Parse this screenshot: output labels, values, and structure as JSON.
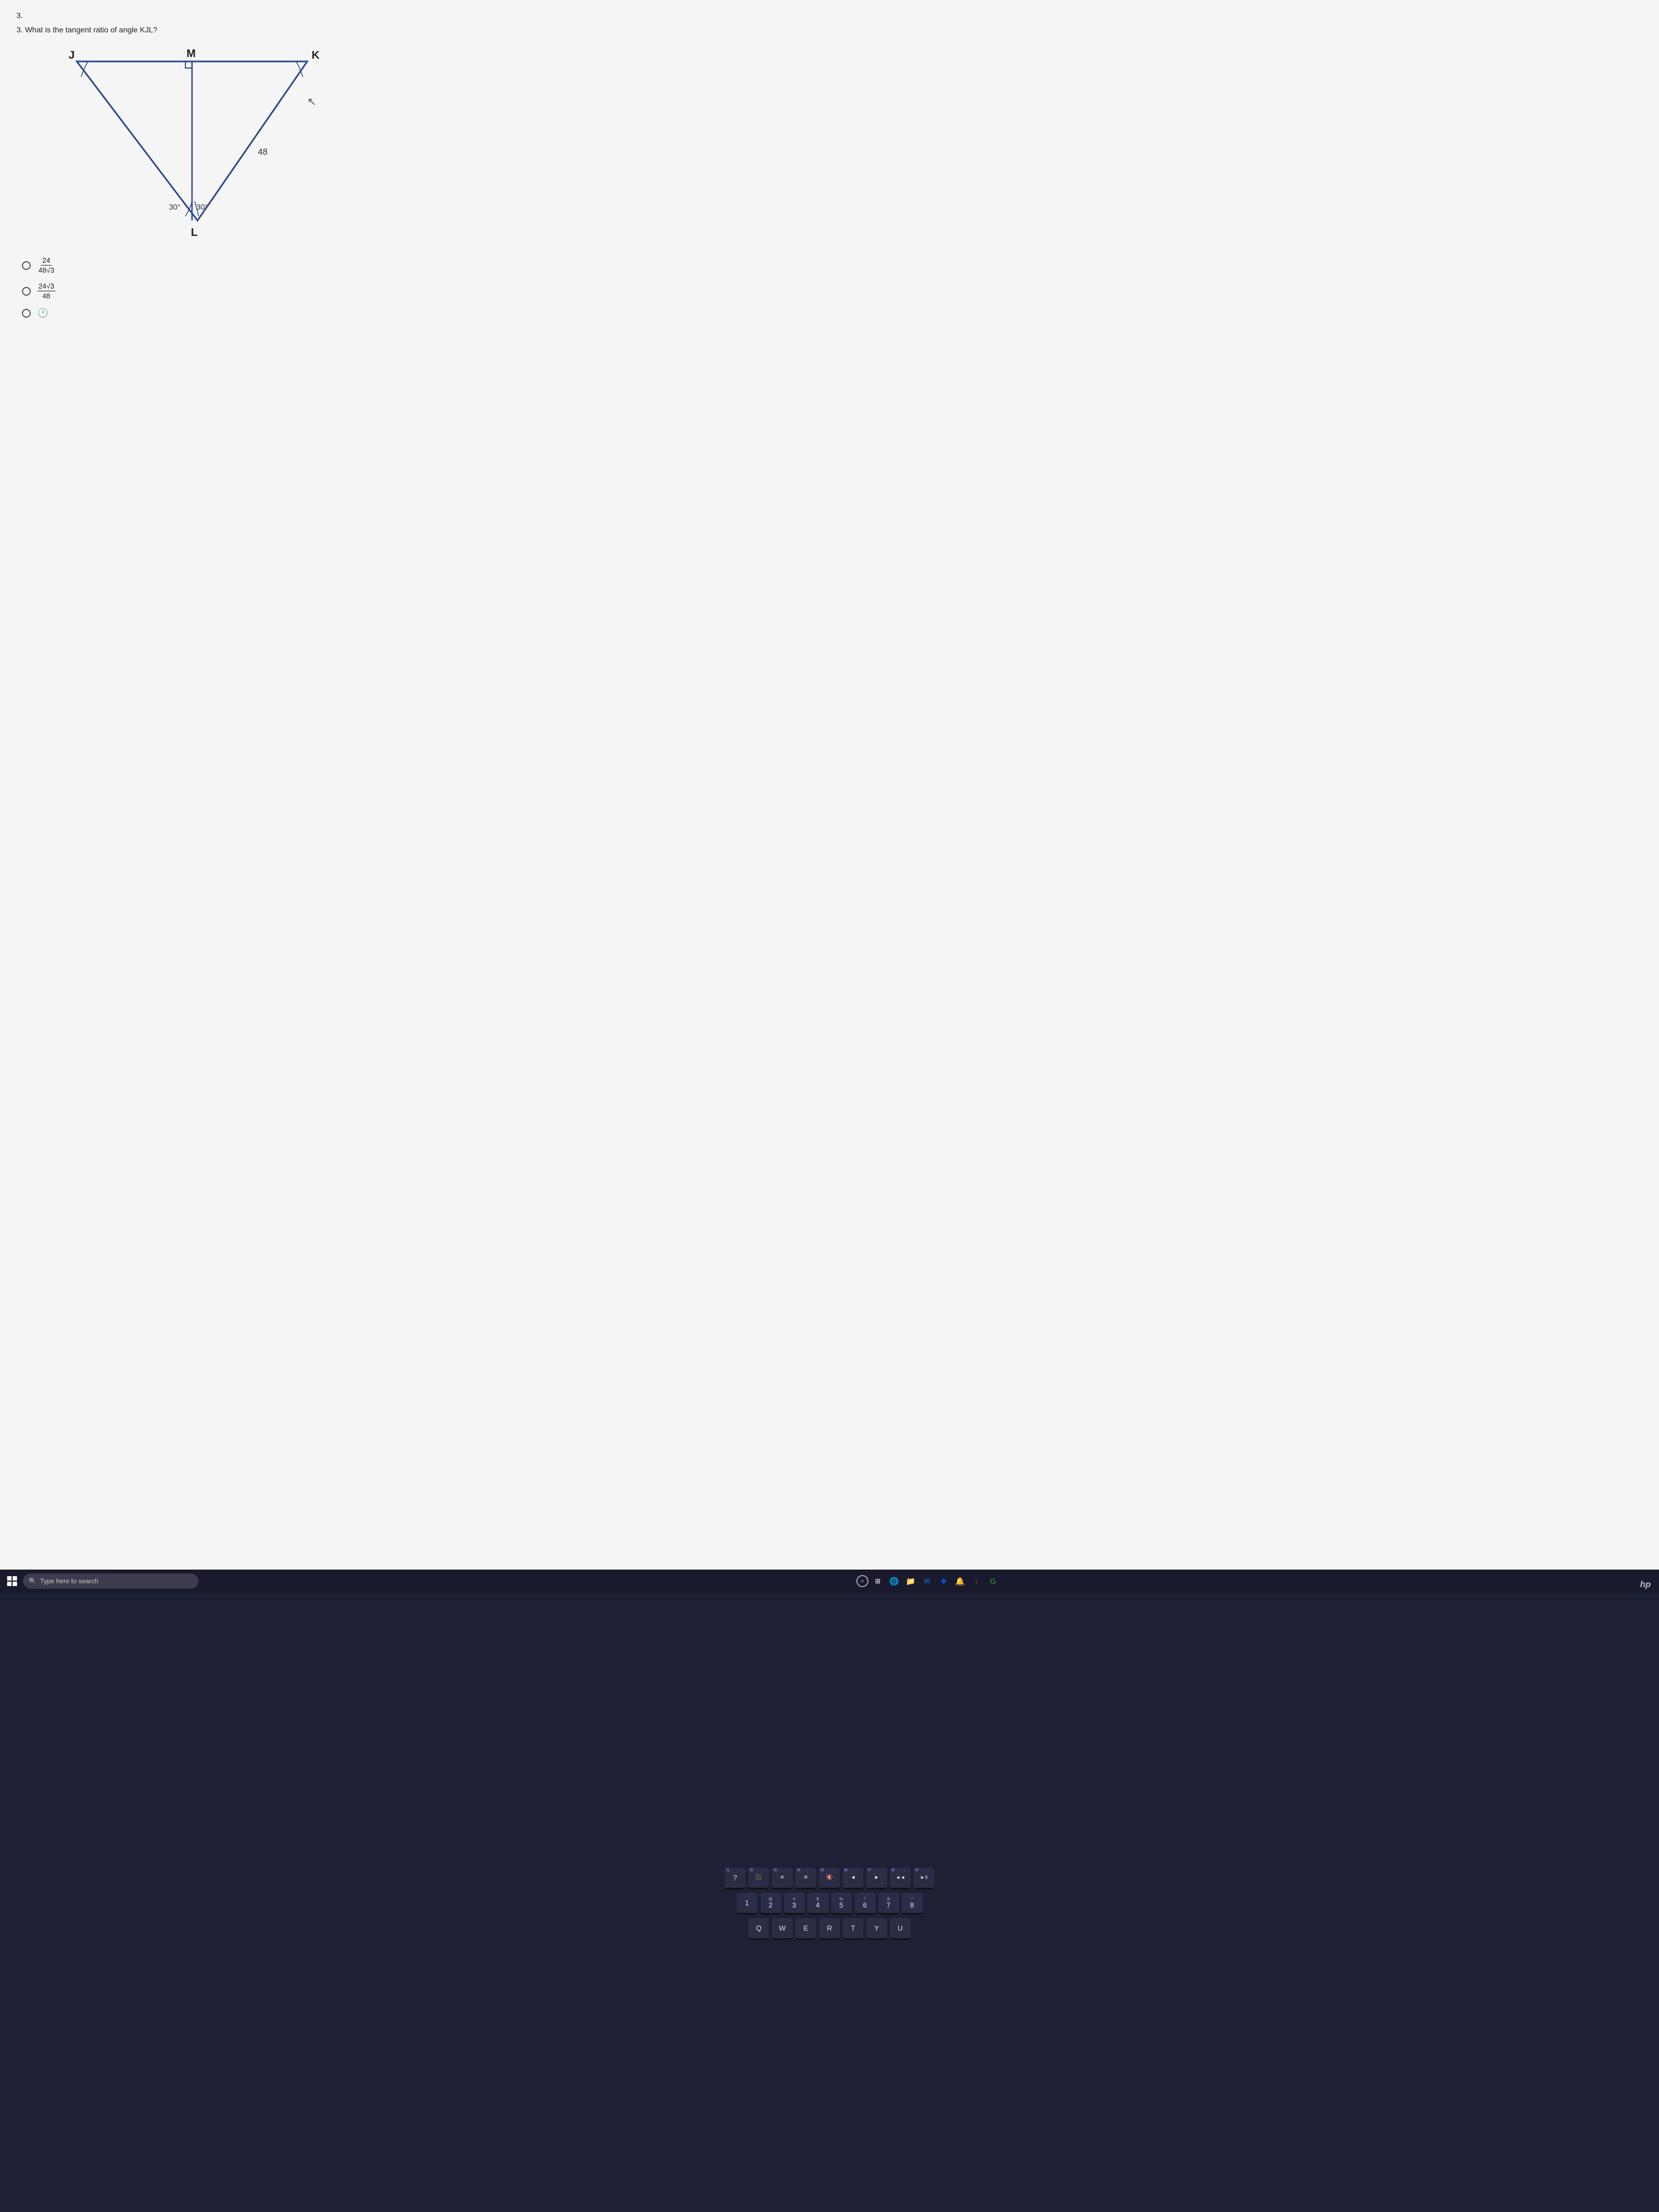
{
  "question": {
    "number": "3.",
    "text": "What is the tangent ratio of angle KJL?"
  },
  "diagram": {
    "vertices": {
      "J": "top-left",
      "M": "top-middle",
      "K": "top-right",
      "L": "bottom-middle"
    },
    "angles": {
      "left": "30°",
      "right": "30°"
    },
    "side_label": "48"
  },
  "answer_choices": [
    {
      "id": "a",
      "numerator": "24",
      "denominator": "48√3",
      "selected": false
    },
    {
      "id": "b",
      "numerator": "24√3",
      "denominator": "48",
      "selected": false
    },
    {
      "id": "c",
      "type": "circle_with_clock",
      "selected": false
    }
  ],
  "taskbar": {
    "search_placeholder": "Type here to search",
    "icons": [
      "⊞",
      "○",
      "▣",
      "🌐",
      "✉",
      "❖",
      "🔔",
      "↑"
    ]
  },
  "keyboard": {
    "rows": [
      {
        "keys": [
          {
            "top": "f1",
            "main": "?"
          },
          {
            "top": "f2",
            "main": "⬛"
          },
          {
            "top": "f3",
            "main": "✳"
          },
          {
            "top": "f4",
            "main": "✳"
          },
          {
            "top": "f5",
            "main": "🔇"
          },
          {
            "top": "f6",
            "main": "◄"
          },
          {
            "top": "f7",
            "main": "►"
          },
          {
            "top": "f8",
            "main": "◄◄"
          },
          {
            "top": "f9",
            "main": "►II"
          }
        ]
      },
      {
        "keys": [
          {
            "top": "@",
            "main": "2"
          },
          {
            "top": "#",
            "main": "3"
          },
          {
            "top": "$",
            "main": "4"
          },
          {
            "top": "%",
            "main": "5"
          },
          {
            "top": "^",
            "main": "6"
          },
          {
            "top": "&",
            "main": "7"
          },
          {
            "top": "*",
            "main": "8"
          }
        ]
      },
      {
        "keys": [
          {
            "main": "Q"
          },
          {
            "main": "W"
          },
          {
            "main": "E"
          },
          {
            "main": "R"
          },
          {
            "main": "T"
          },
          {
            "main": "Y"
          },
          {
            "main": "U"
          }
        ]
      }
    ]
  },
  "hp_brand": "hp"
}
